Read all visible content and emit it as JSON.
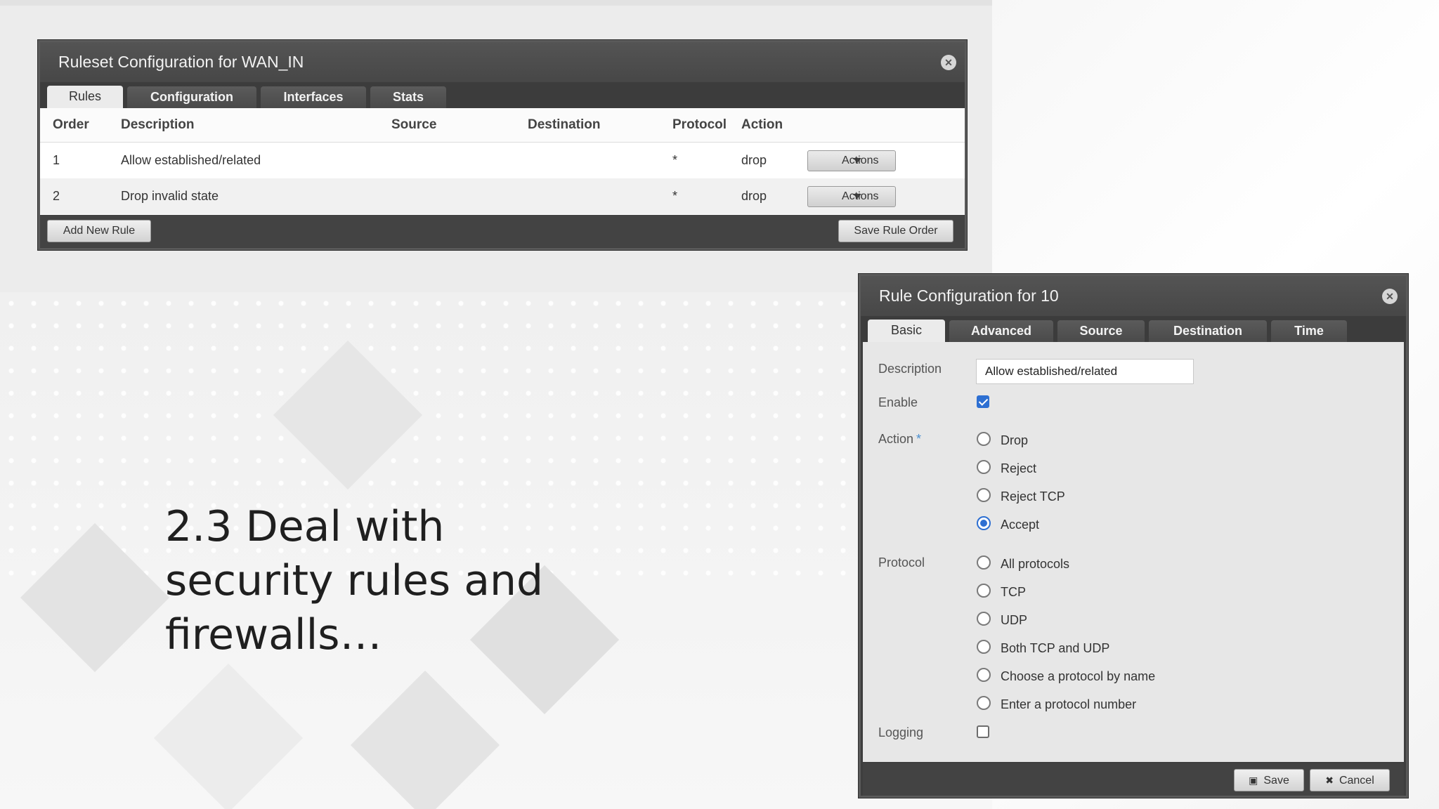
{
  "slide": {
    "headline_lines": [
      "2.3 Deal with",
      "security rules and",
      "firewalls…"
    ]
  },
  "ruleset_dialog": {
    "title": "Ruleset Configuration for WAN_IN",
    "tabs": [
      {
        "label": "Rules",
        "active": true
      },
      {
        "label": "Configuration",
        "active": false
      },
      {
        "label": "Interfaces",
        "active": false
      },
      {
        "label": "Stats",
        "active": false
      }
    ],
    "columns": [
      "Order",
      "Description",
      "Source",
      "Destination",
      "Protocol",
      "Action"
    ],
    "rows": [
      {
        "order": "1",
        "description": "Allow established/related",
        "source": "",
        "destination": "",
        "protocol": "*",
        "action": "drop",
        "actions_label": "Actions"
      },
      {
        "order": "2",
        "description": "Drop invalid state",
        "source": "",
        "destination": "",
        "protocol": "*",
        "action": "drop",
        "actions_label": "Actions"
      }
    ],
    "add_rule_label": "Add New Rule",
    "save_order_label": "Save Rule Order"
  },
  "rule_dialog": {
    "title": "Rule Configuration for 10",
    "tabs": [
      {
        "label": "Basic",
        "active": true
      },
      {
        "label": "Advanced",
        "active": false
      },
      {
        "label": "Source",
        "active": false
      },
      {
        "label": "Destination",
        "active": false
      },
      {
        "label": "Time",
        "active": false
      }
    ],
    "description_label": "Description",
    "description_value": "Allow established/related",
    "enable_label": "Enable",
    "enable_checked": true,
    "action_label": "Action",
    "required_mark": "*",
    "action_options": [
      "Drop",
      "Reject",
      "Reject TCP",
      "Accept"
    ],
    "action_selected": "Accept",
    "protocol_label": "Protocol",
    "protocol_options": [
      "All protocols",
      "TCP",
      "UDP",
      "Both TCP and UDP",
      "Choose a protocol by name",
      "Enter a protocol number"
    ],
    "protocol_selected": null,
    "logging_label": "Logging",
    "logging_checked": false,
    "save_label": "Save",
    "cancel_label": "Cancel"
  },
  "colors": {
    "accent": "#2d6fd2",
    "dialog_bg": "#3e3e3e",
    "form_bg": "#e7e7e7"
  }
}
